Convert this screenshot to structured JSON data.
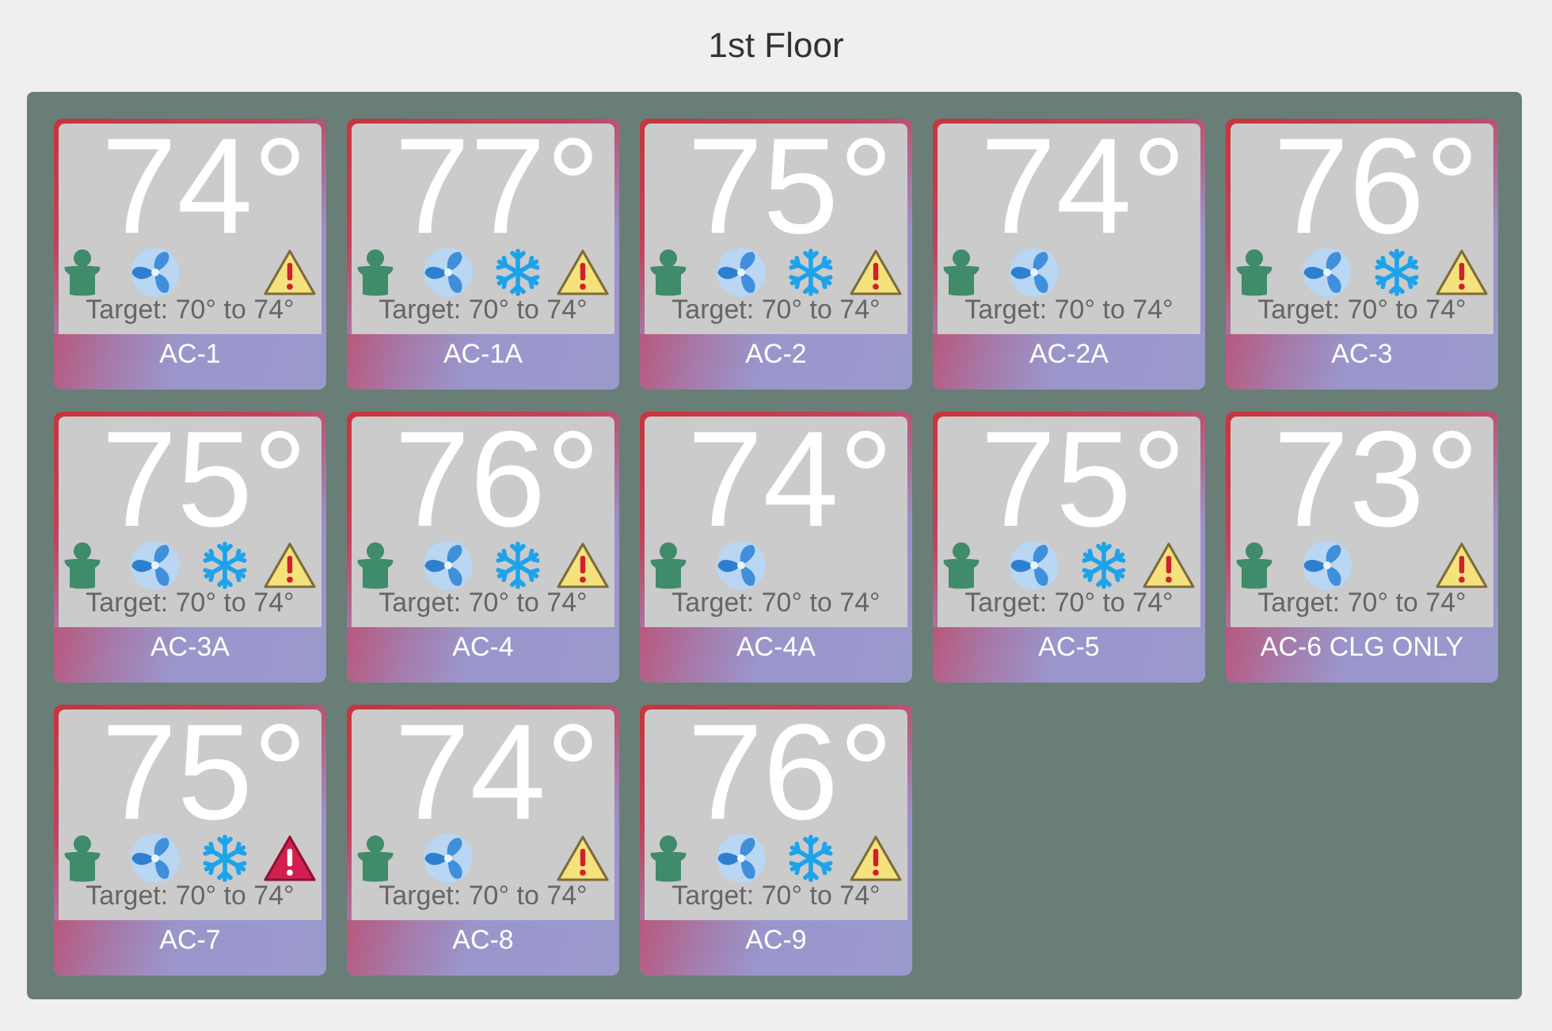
{
  "title": "1st Floor",
  "units": [
    {
      "name": "AC-1",
      "temperature": "74°",
      "target": "Target: 70° to 74°",
      "occupied": true,
      "fan_on": true,
      "cooling": false,
      "alert": true,
      "critical": false
    },
    {
      "name": "AC-1A",
      "temperature": "77°",
      "target": "Target: 70° to 74°",
      "occupied": true,
      "fan_on": true,
      "cooling": true,
      "alert": true,
      "critical": false
    },
    {
      "name": "AC-2",
      "temperature": "75°",
      "target": "Target: 70° to 74°",
      "occupied": true,
      "fan_on": true,
      "cooling": true,
      "alert": true,
      "critical": false
    },
    {
      "name": "AC-2A",
      "temperature": "74°",
      "target": "Target: 70° to 74°",
      "occupied": true,
      "fan_on": true,
      "cooling": false,
      "alert": false,
      "critical": false
    },
    {
      "name": "AC-3",
      "temperature": "76°",
      "target": "Target: 70° to 74°",
      "occupied": true,
      "fan_on": true,
      "cooling": true,
      "alert": true,
      "critical": false
    },
    {
      "name": "AC-3A",
      "temperature": "75°",
      "target": "Target: 70° to 74°",
      "occupied": true,
      "fan_on": true,
      "cooling": true,
      "alert": true,
      "critical": false
    },
    {
      "name": "AC-4",
      "temperature": "76°",
      "target": "Target: 70° to 74°",
      "occupied": true,
      "fan_on": true,
      "cooling": true,
      "alert": true,
      "critical": false
    },
    {
      "name": "AC-4A",
      "temperature": "74°",
      "target": "Target: 70° to 74°",
      "occupied": true,
      "fan_on": true,
      "cooling": false,
      "alert": false,
      "critical": false
    },
    {
      "name": "AC-5",
      "temperature": "75°",
      "target": "Target: 70° to 74°",
      "occupied": true,
      "fan_on": true,
      "cooling": true,
      "alert": true,
      "critical": false
    },
    {
      "name": "AC-6 CLG ONLY",
      "temperature": "73°",
      "target": "Target: 70° to 74°",
      "occupied": true,
      "fan_on": true,
      "cooling": false,
      "alert": true,
      "critical": false
    },
    {
      "name": "AC-7",
      "temperature": "75°",
      "target": "Target: 70° to 74°",
      "occupied": true,
      "fan_on": true,
      "cooling": true,
      "alert": true,
      "critical": true
    },
    {
      "name": "AC-8",
      "temperature": "74°",
      "target": "Target: 70° to 74°",
      "occupied": true,
      "fan_on": true,
      "cooling": false,
      "alert": true,
      "critical": false
    },
    {
      "name": "AC-9",
      "temperature": "76°",
      "target": "Target: 70° to 74°",
      "occupied": true,
      "fan_on": true,
      "cooling": true,
      "alert": true,
      "critical": false
    }
  ]
}
